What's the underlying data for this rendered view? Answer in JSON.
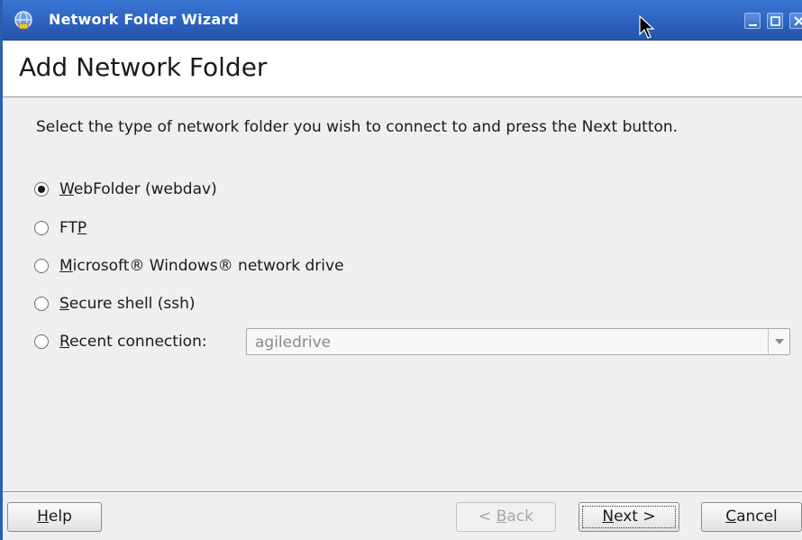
{
  "window": {
    "title": "Network Folder Wizard",
    "icon": "network-folder-icon",
    "controls": [
      "minimize-icon",
      "maximize-icon",
      "close-icon"
    ]
  },
  "header": {
    "title": "Add Network Folder"
  },
  "instruction": "Select the type of network folder you wish to connect to and press the Next button.",
  "options": [
    {
      "mnemonic": "W",
      "rest": "ebFolder (webdav)",
      "checked": true
    },
    {
      "prefix": "FT",
      "mnemonic": "P",
      "checked": false
    },
    {
      "mnemonic": "M",
      "rest": "icrosoft® Windows® network drive",
      "checked": false
    },
    {
      "mnemonic": "S",
      "rest": "ecure shell (ssh)",
      "checked": false
    },
    {
      "mnemonic": "R",
      "rest": "ecent connection:",
      "checked": false
    }
  ],
  "recent_connection": {
    "value": "agiledrive",
    "enabled": false
  },
  "buttons": {
    "help": {
      "mnemonic": "H",
      "rest": "elp"
    },
    "back": {
      "prefix": "< ",
      "mnemonic": "B",
      "rest": "ack",
      "enabled": false
    },
    "next": {
      "mnemonic": "N",
      "rest": "ext >",
      "default": true
    },
    "cancel": {
      "mnemonic": "C",
      "rest": "ancel"
    }
  },
  "colors": {
    "titlebar": "#2c62bf",
    "window_bg": "#efefef",
    "header_bg": "#ffffff"
  }
}
